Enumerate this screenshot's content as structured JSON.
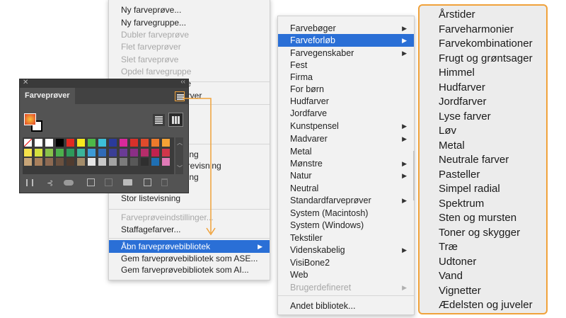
{
  "main_menu": {
    "items": [
      {
        "label": "Ny farveprøve...",
        "disabled": false
      },
      {
        "label": "Ny farvegruppe...",
        "disabled": false
      },
      {
        "label": "Dubler farveprøve",
        "disabled": true
      },
      {
        "label": "Flet farveprøver",
        "disabled": true
      },
      {
        "label": "Slet farveprøve",
        "disabled": true
      },
      {
        "label": "Opdel farvegruppe",
        "disabled": true
      }
    ],
    "partial_items": [
      "te",
      "arver"
    ],
    "hidden_items": [
      "ning",
      "urevisning",
      "ning"
    ],
    "large_list": "Stor listevisning",
    "settings": "Farveprøveindstillinger...",
    "spot": "Staffagefarver...",
    "open_library": "Åbn farveprøvebibliotek",
    "save_ase": "Gem farveprøvebibliotek som ASE...",
    "save_ai": "Gem farveprøvebibliotek som AI..."
  },
  "panel": {
    "title": "Farveprøver",
    "close": "✕",
    "collapse": "‹‹",
    "footer_icons": [
      "library-icon",
      "show-kind-icon",
      "cloud-icon",
      "swatch-options-icon",
      "folder-icon",
      "new-swatch-icon",
      "trash-icon"
    ],
    "swatch_colors": [
      "#ffffff",
      "#ffffff",
      "#ffffff",
      "#000000",
      "#e22a21",
      "#f6e81e",
      "#4db848",
      "#3dbfd8",
      "#2a3a9b",
      "#d8299a",
      "#d9302a",
      "#e04a2c",
      "#ee7a2b",
      "#f5a235",
      "#f7e24a",
      "#d5e03e",
      "#8ac24a",
      "#4cb04c",
      "#2e9a5a",
      "#3ab49a",
      "#3c9ad6",
      "#2f6ab7",
      "#3a3e95",
      "#6a3b95",
      "#8b2e86",
      "#b62d6a",
      "#c2224e",
      "#d0364a",
      "#c8a578",
      "#a9805c",
      "#8e6a52",
      "#6b513f",
      "#4f3b2f",
      "#a38c6a",
      "#e5e5e5",
      "#c8c8c8",
      "#a3a3a3",
      "#7b7b7b",
      "#585858",
      "#2f2f2f",
      "#1f6fb3",
      "#e07ab7"
    ]
  },
  "submenu": {
    "items": [
      {
        "label": "Farvebøger",
        "arrow": true
      },
      {
        "label": "Farveforløb",
        "arrow": true,
        "selected": true
      },
      {
        "label": "Farvegenskaber",
        "arrow": true
      },
      {
        "label": "Fest"
      },
      {
        "label": "Firma"
      },
      {
        "label": "For børn"
      },
      {
        "label": "Hudfarver"
      },
      {
        "label": "Jordfarve"
      },
      {
        "label": "Kunstpensel",
        "arrow": true
      },
      {
        "label": "Madvarer",
        "arrow": true
      },
      {
        "label": "Metal"
      },
      {
        "label": "Mønstre",
        "arrow": true
      },
      {
        "label": "Natur",
        "arrow": true
      },
      {
        "label": "Neutral"
      },
      {
        "label": "Standardfarveprøver",
        "arrow": true
      },
      {
        "label": "System (Macintosh)"
      },
      {
        "label": "System (Windows)"
      },
      {
        "label": "Tekstiler"
      },
      {
        "label": "Videnskabelig",
        "arrow": true
      },
      {
        "label": "VisiBone2"
      },
      {
        "label": "Web"
      },
      {
        "label": "Brugerdefineret",
        "arrow": true,
        "disabled": true
      }
    ],
    "other": "Andet bibliotek..."
  },
  "gradient_list": [
    "Årstider",
    "Farveharmonier",
    "Farvekombinationer",
    "Frugt og grøntsager",
    "Himmel",
    "Hudfarver",
    "Jordfarver",
    "Lyse farver",
    "Løv",
    "Metal",
    "Neutrale farver",
    "Pasteller",
    "Simpel radial",
    "Spektrum",
    "Sten og mursten",
    "Toner og skygger",
    "Træ",
    "Udtoner",
    "Vand",
    "Vignetter",
    "Ædelsten og juveler"
  ],
  "colors": {
    "accent": "#f0a23b",
    "selection": "#2a6fd6"
  },
  "arrow_glyph": "▶"
}
